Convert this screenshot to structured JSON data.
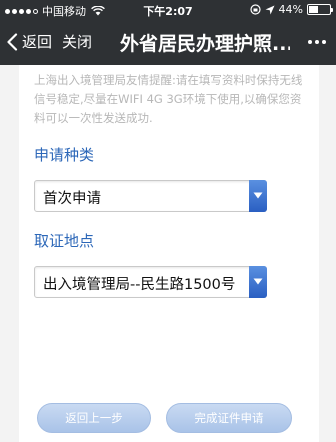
{
  "status_bar": {
    "carrier": "中国移动",
    "time": "下午2:07",
    "battery": "44%",
    "battery_level": 0.44,
    "icons": [
      "signal-dots-icon",
      "wifi-icon",
      "lock-rotation-icon",
      "location-arrow-icon",
      "battery-icon"
    ]
  },
  "nav": {
    "back_label": "返回",
    "close_label": "关闭",
    "title": "外省居民办理护照...",
    "icons": [
      "chevron-left-icon",
      "more-icon"
    ]
  },
  "form": {
    "notice": "上海出入境管理局友情提醒:请在填写资料时保持无线信号稳定,尽量在WIFI 4G 3G环境下使用,以确保您资料可以一次性发送成功.",
    "type_label": "申请种类",
    "type_value": "首次申请",
    "location_label": "取证地点",
    "location_value": "出入境管理局--民生路1500号"
  },
  "buttons": {
    "back_step": "返回上一步",
    "finish": "完成证件申请"
  },
  "colors": {
    "bar_bg": "#2e3134",
    "label_blue": "#2c67b8",
    "select_arrow": "#3a6fd0",
    "button_bg": "#b8cfee"
  }
}
